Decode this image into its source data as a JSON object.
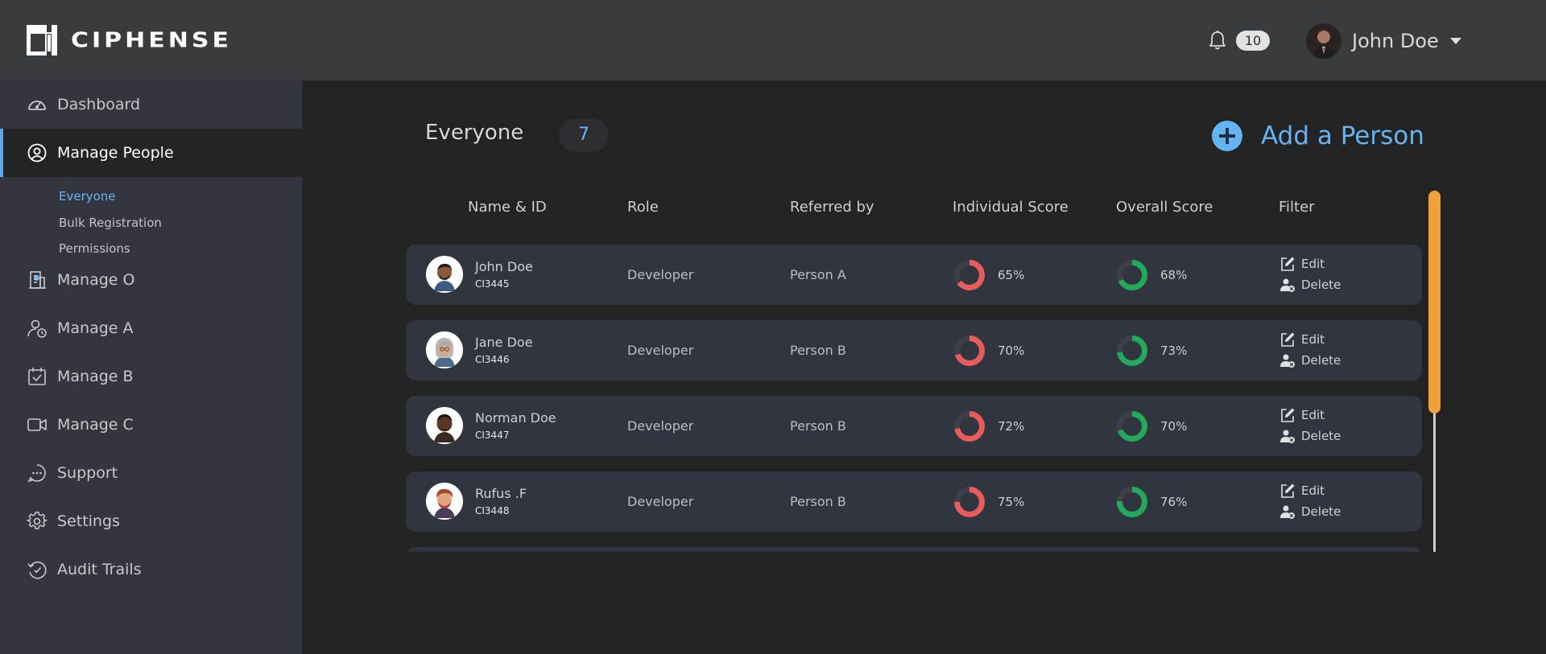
{
  "app": {
    "logo_text": "CIPHENSE",
    "notifications_count": "10",
    "user_name": "John Doe"
  },
  "sidebar": {
    "items": [
      {
        "label": "Dashboard",
        "icon": "speedometer-icon"
      },
      {
        "label": "Manage People",
        "icon": "user-circle-icon"
      },
      {
        "label": "Manage O",
        "icon": "building-icon"
      },
      {
        "label": "Manage A",
        "icon": "user-clock-icon"
      },
      {
        "label": "Manage B",
        "icon": "calendar-check-icon"
      },
      {
        "label": "Manage C",
        "icon": "video-camera-icon"
      },
      {
        "label": "Support",
        "icon": "chat-bubble-icon"
      },
      {
        "label": "Settings",
        "icon": "gear-icon"
      },
      {
        "label": "Audit Trails",
        "icon": "history-icon"
      }
    ],
    "sub_items": [
      {
        "label": "Everyone"
      },
      {
        "label": "Bulk Registration"
      },
      {
        "label": "Permissions"
      }
    ]
  },
  "main": {
    "heading": "Everyone",
    "count": "7",
    "add_label": "Add a Person",
    "columns": [
      "Name & ID",
      "Role",
      "Referred by",
      "Individual Score",
      "Overall Score",
      "Filter"
    ],
    "edit_label": "Edit",
    "delete_label": "Delete",
    "rows": [
      {
        "name": "John Doe",
        "id": "CI3445",
        "role": "Developer",
        "referred_by": "Person A",
        "individual": "65%",
        "individual_value": 65,
        "overall": "68%",
        "overall_value": 68
      },
      {
        "name": "Jane Doe",
        "id": "CI3446",
        "role": "Developer",
        "referred_by": "Person B",
        "individual": "70%",
        "individual_value": 70,
        "overall": "73%",
        "overall_value": 73
      },
      {
        "name": "Norman Doe",
        "id": "CI3447",
        "role": "Developer",
        "referred_by": "Person B",
        "individual": "72%",
        "individual_value": 72,
        "overall": "70%",
        "overall_value": 70
      },
      {
        "name": "Rufus .F",
        "id": "CI3448",
        "role": "Developer",
        "referred_by": "Person B",
        "individual": "75%",
        "individual_value": 75,
        "overall": "76%",
        "overall_value": 76
      }
    ]
  },
  "colors": {
    "accent": "#64b3f2",
    "individual_score": "#e85c5c",
    "overall_score": "#22a95a",
    "scroll_thumb": "#f0a13a"
  }
}
